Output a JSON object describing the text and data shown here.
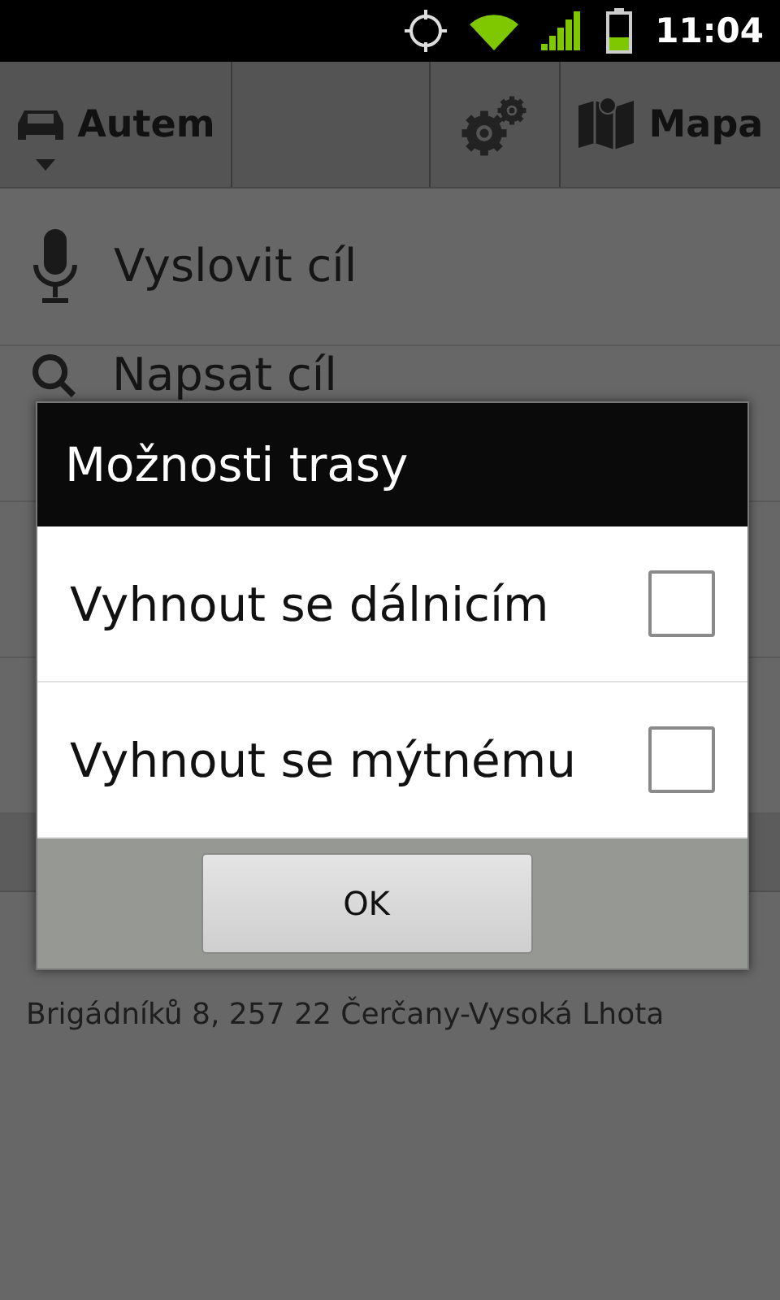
{
  "status_bar": {
    "time": "11:04"
  },
  "toolbar": {
    "mode": {
      "label": "Autem"
    },
    "map": {
      "label": "Mapa"
    }
  },
  "list": [
    {
      "kind": "voice",
      "label": "Vyslovit cíl"
    },
    {
      "kind": "search",
      "label": "Napsat cíl"
    },
    {
      "kind": "blank"
    },
    {
      "kind": "blank"
    },
    {
      "kind": "header"
    },
    {
      "kind": "address",
      "secondary": "Brigádníků 8, 257 22 Čerčany-Vysoká Lhota"
    }
  ],
  "dialog": {
    "title": "Možnosti trasy",
    "options": [
      {
        "label": "Vyhnout se dálnicím",
        "checked": false
      },
      {
        "label": "Vyhnout se mýtnému",
        "checked": false
      }
    ],
    "button": "OK"
  }
}
